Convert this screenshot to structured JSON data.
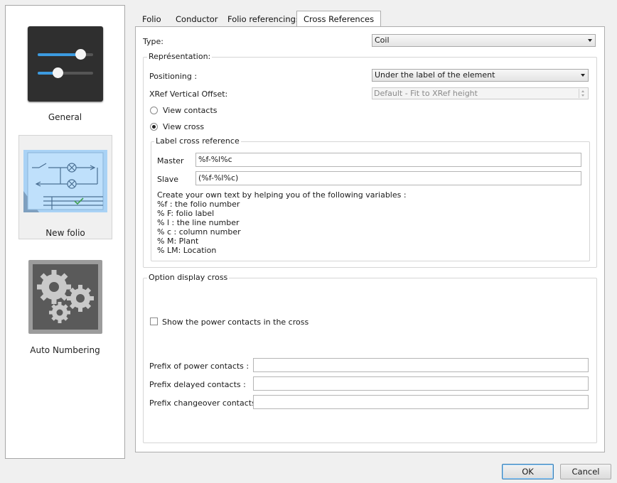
{
  "sidebar": {
    "items": [
      {
        "label": "General",
        "icon": "sliders-icon"
      },
      {
        "label": "New folio",
        "icon": "folio-schematic-icon"
      },
      {
        "label": "Auto Numbering",
        "icon": "gears-icon"
      }
    ],
    "selected": "New folio"
  },
  "tabs": [
    {
      "label": "Folio"
    },
    {
      "label": "Conductor"
    },
    {
      "label": "Folio referencings"
    },
    {
      "label": "Cross References"
    }
  ],
  "active_tab": "Cross References",
  "cross": {
    "type_label": "Type:",
    "type_value": "Coil",
    "representation_title": "Représentation:",
    "positioning_label": "Positioning :",
    "positioning_value": "Under the label of the element",
    "xref_offset_label": "XRef Vertical Offset:",
    "xref_offset_value": "Default - Fit to XRef height",
    "view_contacts_label": "View contacts",
    "view_cross_label": "View cross",
    "view_selected": "View cross",
    "label_group_title": "Label cross reference",
    "master_label": "Master",
    "master_value": "%f-%l%c",
    "slave_label": "Slave",
    "slave_value": "(%f-%l%c)",
    "help_lines": [
      "Create your own text by helping you of the following variables :",
      "%f : the folio number",
      "% F: folio label",
      "% l : the line number",
      "% c : column number",
      "% M: Plant",
      "% LM: Location"
    ],
    "option_title": "Option display cross",
    "show_power_label": "Show the power contacts in the cross",
    "show_power_checked": false,
    "prefix_power_label": "Prefix of power contacts :",
    "prefix_power_value": "",
    "prefix_delayed_label": "Prefix delayed contacts :",
    "prefix_delayed_value": "",
    "prefix_changeover_label": "Prefix changeover contacts :",
    "prefix_changeover_value": ""
  },
  "buttons": {
    "ok": "OK",
    "cancel": "Cancel"
  },
  "colors": {
    "accent": "#3c9be0",
    "selected_bg": "#f0f0f0"
  }
}
